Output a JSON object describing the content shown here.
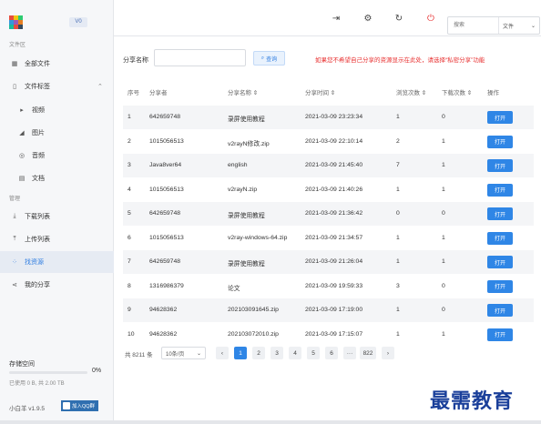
{
  "sidebar": {
    "version": "V0",
    "section_files": "文件区",
    "section_manage": "管理",
    "items": [
      {
        "label": "全部文件",
        "icon": "grid-icon"
      },
      {
        "label": "文件标签",
        "icon": "document-icon",
        "expanded": true
      },
      {
        "label": "视频",
        "icon": "play-icon"
      },
      {
        "label": "图片",
        "icon": "image-icon"
      },
      {
        "label": "音频",
        "icon": "audio-icon"
      },
      {
        "label": "文档",
        "icon": "file-icon"
      },
      {
        "label": "下载列表",
        "icon": "download-icon"
      },
      {
        "label": "上传列表",
        "icon": "upload-icon"
      },
      {
        "label": "找资源",
        "icon": "apps-icon",
        "active": true
      },
      {
        "label": "我的分享",
        "icon": "share-icon"
      }
    ],
    "storage_title": "存储空间",
    "storage_percent": "0%",
    "storage_fraction": 0.0,
    "storage_used": "已使用 0 B, 共 2.00 TB",
    "brand": "小白羊 v1.9.5",
    "qq_label": "加入QQ群"
  },
  "toolbar": {
    "search_placeholder": "搜索",
    "search_scope": "文件",
    "icons": [
      "logout-icon",
      "settings-icon",
      "refresh-icon",
      "power-icon"
    ]
  },
  "filter": {
    "label": "分享名称",
    "query_button": "查询",
    "tip": "如果您不希望自己分享的资源显示在此处，请选择“私密分享”功能"
  },
  "table": {
    "headers": [
      "序号",
      "分享者",
      "分享名称 ⇕",
      "分享时间 ⇕",
      "浏览次数 ⇕",
      "下载次数 ⇕",
      "操作"
    ],
    "open_label": "打开",
    "rows": [
      [
        "1",
        "642659748",
        "录屏使用教程",
        "2021-03-09 23:23:34",
        "1",
        "0"
      ],
      [
        "2",
        "1015056513",
        "v2rayN修改.zip",
        "2021-03-09 22:10:14",
        "2",
        "1"
      ],
      [
        "3",
        "Java8ver64",
        "english",
        "2021-03-09 21:45:40",
        "7",
        "1"
      ],
      [
        "4",
        "1015056513",
        "v2rayN.zip",
        "2021-03-09 21:40:26",
        "1",
        "1"
      ],
      [
        "5",
        "642659748",
        "录屏使用教程",
        "2021-03-09 21:36:42",
        "0",
        "0"
      ],
      [
        "6",
        "1015056513",
        "v2ray-windows-64.zip",
        "2021-03-09 21:34:57",
        "1",
        "1"
      ],
      [
        "7",
        "642659748",
        "录屏使用教程",
        "2021-03-09 21:26:04",
        "1",
        "1"
      ],
      [
        "8",
        "1316986379",
        "论文",
        "2021-03-09 19:59:33",
        "3",
        "0"
      ],
      [
        "9",
        "94628362",
        "202103091645.zip",
        "2021-03-09 17:19:00",
        "1",
        "0"
      ],
      [
        "10",
        "94628362",
        "202103072010.zip",
        "2021-03-09 17:15:07",
        "1",
        "1"
      ]
    ]
  },
  "pager": {
    "total": "共 8211 条",
    "page_size": "10条/页",
    "pages": [
      "1",
      "2",
      "3",
      "4",
      "5",
      "6",
      "···",
      "822"
    ],
    "current": "1",
    "prev": "‹",
    "next": "›"
  },
  "watermark": "最需教育"
}
